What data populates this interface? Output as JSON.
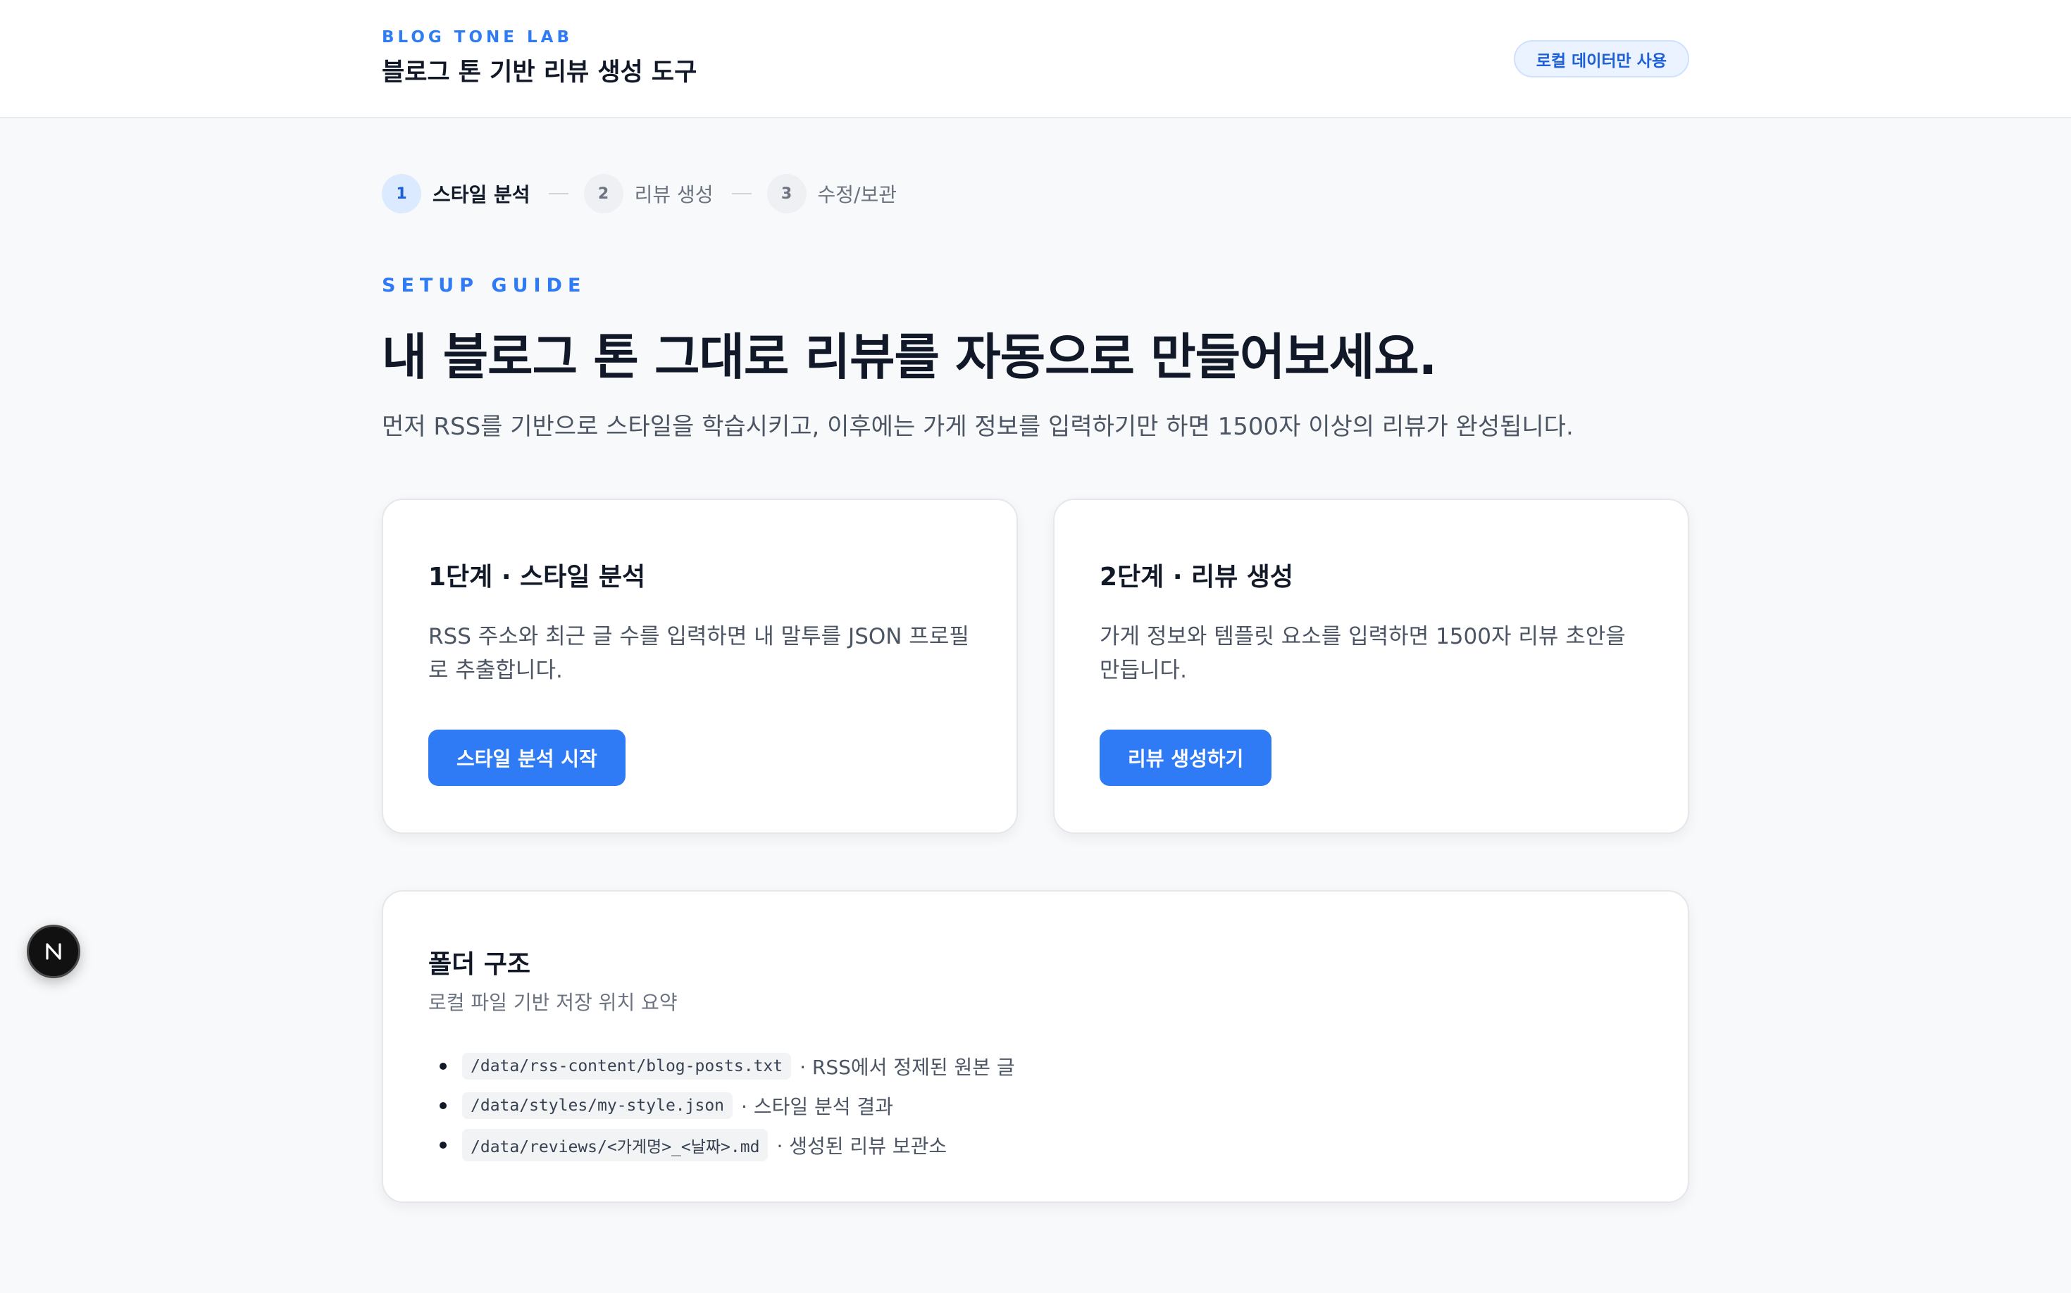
{
  "header": {
    "eyebrow": "BLOG TONE LAB",
    "title": "블로그 톤 기반 리뷰 생성 도구",
    "badge": "로컬 데이터만 사용"
  },
  "stepper": {
    "steps": [
      {
        "number": "1",
        "label": "스타일 분석"
      },
      {
        "number": "2",
        "label": "리뷰 생성"
      },
      {
        "number": "3",
        "label": "수정/보관"
      }
    ]
  },
  "hero": {
    "eyebrow": "SETUP GUIDE",
    "headline": "내 블로그 톤 그대로 리뷰를 자동으로 만들어보세요.",
    "subtitle": "먼저 RSS를 기반으로 스타일을 학습시키고, 이후에는 가게 정보를 입력하기만 하면 1500자 이상의 리뷰가 완성됩니다."
  },
  "cards": {
    "step1": {
      "title": "1단계 · 스타일 분석",
      "description": "RSS 주소와 최근 글 수를 입력하면 내 말투를 JSON 프로필로 추출합니다.",
      "button": "스타일 분석 시작"
    },
    "step2": {
      "title": "2단계 · 리뷰 생성",
      "description": "가게 정보와 템플릿 요소를 입력하면 1500자 리뷰 초안을 만듭니다.",
      "button": "리뷰 생성하기"
    }
  },
  "folders": {
    "title": "폴더 구조",
    "subtitle": "로컬 파일 기반 저장 위치 요약",
    "items": [
      {
        "path": "/data/rss-content/blog-posts.txt",
        "desc": "· RSS에서 정제된 원본 글"
      },
      {
        "path": "/data/styles/my-style.json",
        "desc": "· 스타일 분석 결과"
      },
      {
        "path": "/data/reviews/<가게명>_<날짜>.md",
        "desc": "· 생성된 리뷰 보관소"
      }
    ]
  },
  "dev_indicator": {
    "letter": "N",
    "icon": "nextjs-logo-icon"
  },
  "colors": {
    "accent": "#2f7bf6",
    "badge_bg": "#eaf3ff",
    "page_bg": "#f8f9fb",
    "text_primary": "#111827",
    "text_secondary": "#4b5563"
  }
}
